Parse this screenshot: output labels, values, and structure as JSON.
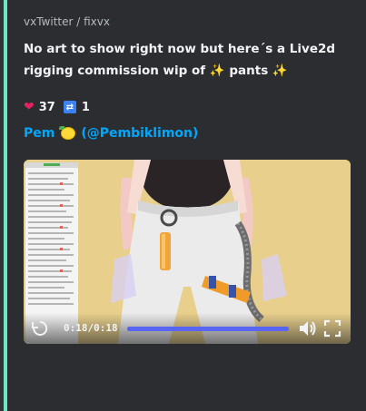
{
  "embed": {
    "provider": "vxTwitter / fixvx",
    "title": "No art to show right now but here´s a Live2d rigging commission wip of  ✨ pants ✨",
    "likes": "37",
    "retweets": "1",
    "author_name": "Pem",
    "author_handle": "(@Pembiklimon)",
    "accent_color": "#6ee7c8"
  },
  "video": {
    "time_current": "0:18",
    "time_separator": "/",
    "time_total": "0:18",
    "progress": 1.0,
    "icons": [
      "replay-icon",
      "volume-icon",
      "fullscreen-icon"
    ]
  }
}
